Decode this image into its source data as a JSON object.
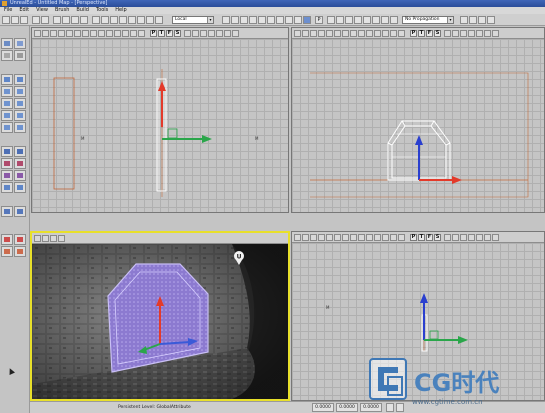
{
  "window": {
    "title": "UnrealEd - Untitled Map - [Perspective]"
  },
  "menu": [
    "File",
    "Edit",
    "View",
    "Brush",
    "Build",
    "Tools",
    "Help"
  ],
  "toolbar": {
    "coord_system": "Local",
    "propagation": "No Propagation",
    "p_label": "P"
  },
  "viewports": {
    "buttons": [
      "P",
      "T",
      "F",
      "S"
    ]
  },
  "status": {
    "level": "Persistent Level: GlobalAttribute",
    "coords": [
      "0.0000",
      "0.0000",
      "0.0000"
    ]
  },
  "watermark": {
    "brand": "CG时代",
    "site": "www.cgtime.com.cn"
  }
}
